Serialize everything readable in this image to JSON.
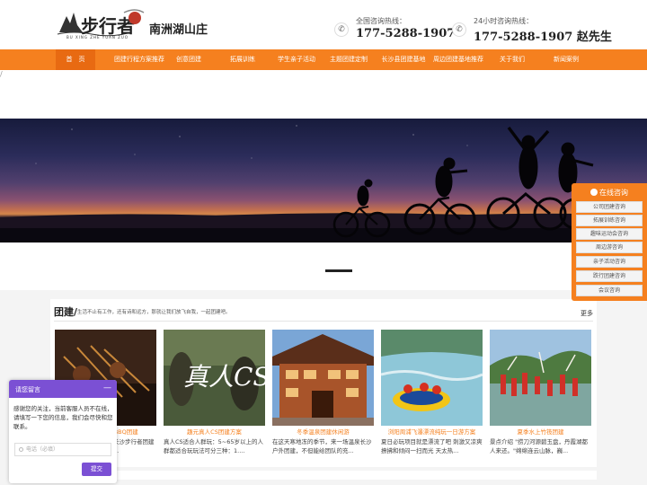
{
  "header": {
    "brand": "南洲湖山庄",
    "logo_sub": "BU XING ZHE YUAN ZUO",
    "hotline1": {
      "label": "全国咨询热线：",
      "number": "177-5288-1907"
    },
    "hotline2": {
      "label": "24小时咨询热线：",
      "number": "177-5288-1907 赵先生"
    }
  },
  "nav": {
    "items": [
      {
        "label": "首　页"
      },
      {
        "label": "团建行程方案推荐"
      },
      {
        "label": "创意团建"
      },
      {
        "label": "拓展训练"
      },
      {
        "label": "学生亲子活动"
      },
      {
        "label": "主题团建定制"
      },
      {
        "label": "长沙县团建基地"
      },
      {
        "label": "周边团建基地推荐"
      },
      {
        "label": "关于我们"
      },
      {
        "label": "新闻案例"
      }
    ]
  },
  "breadcrumb": "/",
  "panel": {
    "title": "团建/",
    "desc": "生活不止有工作，还有诗和远方，那就让我们放飞自我，一起团建吧。",
    "more": "更多",
    "cards": [
      {
        "title": "长沙县户外团建BBQ团建",
        "desc": "团建+BBQ烧烤活动，长沙步行者团建基地有大量烧烤、食材..."
      },
      {
        "title": "趣元真人CS团建方案",
        "desc": "真人CS适合人群玩：5~65岁以上的人群都适合玩玩法可分三种：1...."
      },
      {
        "title": "冬季温泉团建休闲游",
        "desc": "在这天寒地冻的季节，来一场温泉长沙户外团建，不但能给团队的充..."
      },
      {
        "title": "浏阳周浦飞瀑漂流纯玩一日游方案",
        "desc": "夏日必玩项目就是漂流了吧 刺激又凉爽撩拂和倾闷一扫而光 天太热..."
      },
      {
        "title": "夏季水上竹筏团建",
        "desc": "景点介绍 \"捞刀河源碧玉盘，丹霞湖都人来还。\"绵绵连云山脉，巍..."
      }
    ]
  },
  "consult": {
    "title": "在线咨询",
    "items": [
      "公司团建咨询",
      "拓展训练咨询",
      "趣味运动会咨询",
      "周边游咨询",
      "亲子活动咨询",
      "跌行团建咨询",
      "会议咨询"
    ]
  },
  "chat": {
    "title": "请您留言",
    "minimize": "—",
    "message": "感谢您的关注，当前客服人员不在线，请填写一下您的信息，我们会尽快和您联系。",
    "phone_placeholder": "电话（必填）",
    "submit": "提交"
  }
}
